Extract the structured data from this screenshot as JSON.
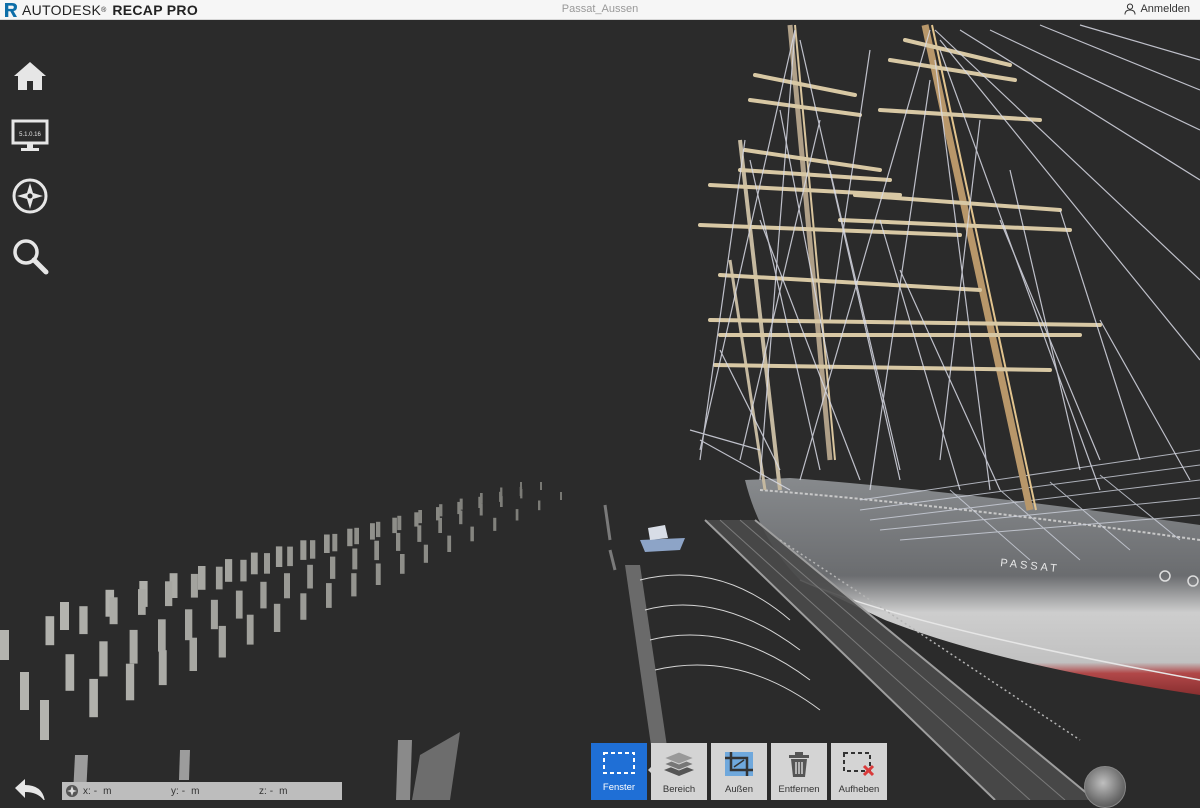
{
  "app": {
    "brand_name": "AUTODESK",
    "brand_reg": "®",
    "product": "RECAP PRO",
    "document_title": "Passat_Aussen",
    "signin_label": "Anmelden"
  },
  "nav": {
    "home_icon": "home-icon",
    "display_icon": "monitor-icon",
    "display_version": "5.1.0.16",
    "orbit_icon": "compass-icon",
    "zoom_icon": "magnifier-icon",
    "back_icon": "undo-arrow-icon"
  },
  "coords": {
    "x_label": "x:",
    "x_value": "-",
    "x_unit": "m",
    "y_label": "y:",
    "y_value": "-",
    "y_unit": "m",
    "z_label": "z:",
    "z_value": "-",
    "z_unit": "m"
  },
  "toolbar": {
    "items": [
      {
        "label": "Fenster",
        "icon": "window-select-icon",
        "active": true
      },
      {
        "label": "Bereich",
        "icon": "layers-icon",
        "active": false
      },
      {
        "label": "Außen",
        "icon": "crop-outside-icon",
        "active": false
      },
      {
        "label": "Entfernen",
        "icon": "trash-icon",
        "active": false
      },
      {
        "label": "Aufheben",
        "icon": "clear-selection-icon",
        "active": false
      }
    ]
  },
  "scene": {
    "ship_name": "PASSAT",
    "background_color": "#2b2b2b",
    "accent_color": "#1f6fd6"
  }
}
